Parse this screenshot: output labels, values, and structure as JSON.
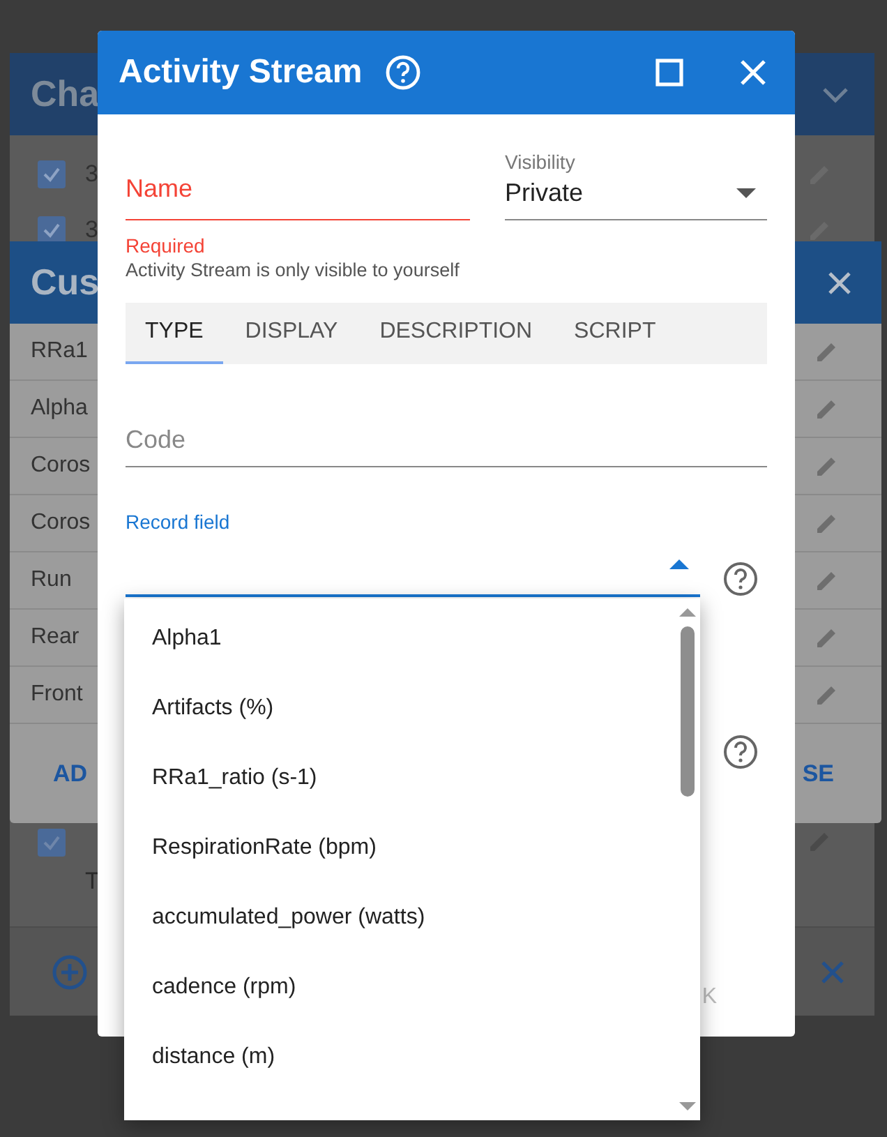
{
  "back_dialog": {
    "title": "Cha",
    "rows": [
      {
        "label": "3",
        "checked": true
      },
      {
        "label": "3",
        "checked": true
      }
    ],
    "lower_row": {
      "sublabel": "T",
      "checked": true
    }
  },
  "custom_dialog": {
    "title": "Cus",
    "rows": [
      "RRa1",
      "Alpha",
      "Coros",
      "Coros",
      "Run",
      "Rear",
      "Front"
    ],
    "add_button": "AD",
    "close_button": "SE"
  },
  "dialog": {
    "title": "Activity Stream",
    "name_field": {
      "placeholder": "Name",
      "error": "Required"
    },
    "visibility": {
      "label": "Visibility",
      "value": "Private"
    },
    "hint": "Activity Stream is only visible to yourself",
    "tabs": [
      {
        "label": "TYPE",
        "selected": true
      },
      {
        "label": "DISPLAY",
        "selected": false
      },
      {
        "label": "DESCRIPTION",
        "selected": false
      },
      {
        "label": "SCRIPT",
        "selected": false
      }
    ],
    "code_field": {
      "placeholder": "Code"
    },
    "record_field": {
      "label": "Record field",
      "expanded": true,
      "options": [
        "Alpha1",
        "Artifacts (%)",
        "RRa1_ratio (s-1)",
        "RespirationRate (bpm)",
        "accumulated_power (watts)",
        "cadence (rpm)",
        "distance (m)"
      ]
    },
    "ok_button": "K"
  }
}
